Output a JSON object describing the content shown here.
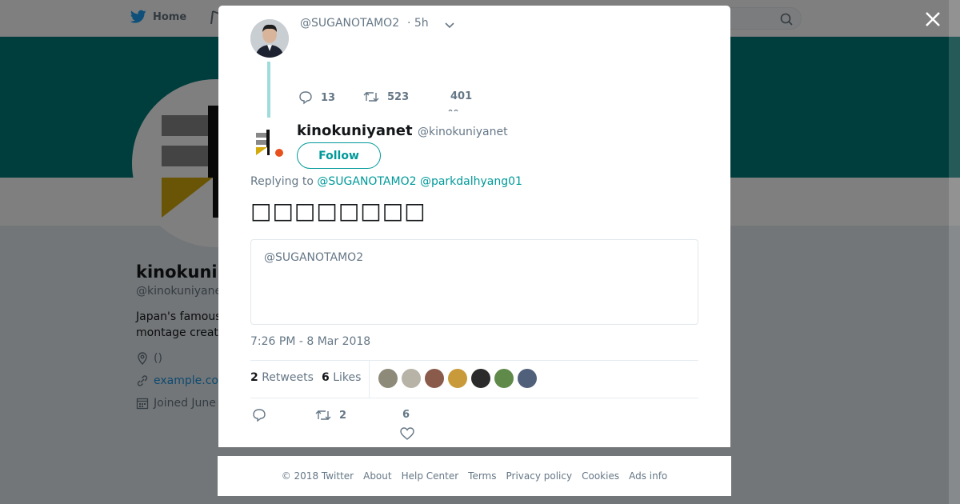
{
  "background": {
    "nav_home": "Home",
    "profile": {
      "name": "kinokuni",
      "handle": "@kinokuniyane",
      "bio_line1": "Japan's famous",
      "bio_line2": "montage creat",
      "location": "()",
      "url": "example.co",
      "joined": "Joined June"
    },
    "banner_color": "#017d7a"
  },
  "parent_tweet": {
    "handle": "@SUGANOTAMO2",
    "time": "· 5h",
    "replies": "13",
    "retweets": "523",
    "likes": "401"
  },
  "tweet": {
    "name": "kinokuniyanet",
    "handle": "@kinokuniyanet",
    "follow_label": "Follow",
    "replying_prefix": "Replying to",
    "replying_mention1": "@SUGANOTAMO2",
    "replying_mention2": "@parkdalhyang01",
    "text": "□□□□□□□□",
    "quote_handle": "@SUGANOTAMO2",
    "date": "7:26 PM - 8 Mar 2018",
    "retweet_count": "2",
    "retweet_label": "Retweets",
    "like_count": "6",
    "like_label": "Likes",
    "action_retweets": "2",
    "action_likes": "6"
  },
  "likers": [
    "#8d8a7a",
    "#b7b3a6",
    "#8a5a4a",
    "#c89a3a",
    "#2b2b2b",
    "#5f8a4a",
    "#50607a"
  ],
  "footer": [
    "© 2018 Twitter",
    "About",
    "Help Center",
    "Terms",
    "Privacy policy",
    "Cookies",
    "Ads info"
  ],
  "colors": {
    "accent": "#009999",
    "thread_line": "#a0dbdb"
  }
}
